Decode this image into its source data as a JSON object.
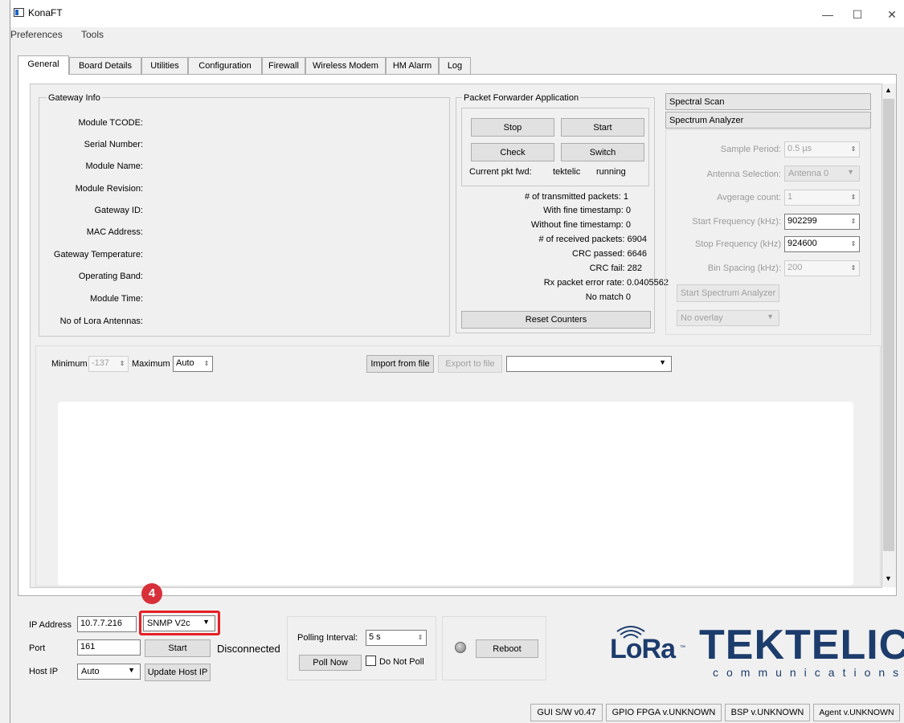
{
  "window": {
    "title": "KonaFT",
    "minimize": "—",
    "maximize": "☐",
    "close": "✕"
  },
  "menu": [
    "Preferences",
    "Tools"
  ],
  "tabs": [
    "General",
    "Board Details",
    "Utilities",
    "Configuration",
    "Firewall",
    "Wireless Modem",
    "HM Alarm",
    "Log"
  ],
  "gateway_info": {
    "title": "Gateway Info",
    "labels": [
      "Module TCODE:",
      "Serial Number:",
      "Module Name:",
      "Module Revision:",
      "Gateway ID:",
      "MAC Address:",
      "Gateway Temperature:",
      "Operating Band:",
      "Module Time:",
      "No of Lora Antennas:"
    ]
  },
  "packet_forwarder": {
    "title": "Packet Forwarder Application",
    "stop": "Stop",
    "start": "Start",
    "check": "Check",
    "switch": "Switch",
    "current_label": "Current pkt fwd:",
    "current_name": "tektelic",
    "current_state": "running",
    "stats": [
      "# of transmitted packets:  1",
      "With fine timestamp:  0",
      "Without fine timestamp:  0",
      "# of received packets:  6904",
      "CRC passed:  6646",
      "CRC fail:  282",
      "Rx packet error rate:  0.0405562",
      "No match  0"
    ],
    "reset": "Reset Counters"
  },
  "spectral": {
    "tab1": "Spectral Scan",
    "tab2": "Spectrum Analyzer",
    "sample_period_label": "Sample Period:",
    "sample_period": "0.5 µs",
    "antenna_label": "Antenna Selection:",
    "antenna": "Antenna 0",
    "avg_label": "Avgerage count:",
    "avg": "1",
    "start_freq_label": "Start Frequency (kHz):",
    "start_freq": "902299",
    "stop_freq_label": "Stop Frequency (kHz)",
    "stop_freq": "924600",
    "bin_label": "Bin Spacing (kHz):",
    "bin": "200",
    "start_btn": "Start Spectrum Analyzer",
    "overlay": "No overlay"
  },
  "plot_controls": {
    "min_label": "Minimum",
    "min": "-137",
    "max_label": "Maximum",
    "max": "Auto",
    "import": "Import from file",
    "export": "Export to file"
  },
  "connection": {
    "ip_label": "IP Address",
    "ip": "10.7.7.216",
    "protocol": "SNMP V2c",
    "port_label": "Port",
    "port": "161",
    "start": "Start",
    "status": "Disconnected",
    "host_label": "Host IP",
    "host": "Auto",
    "update_host": "Update Host IP"
  },
  "polling": {
    "label": "Polling Interval:",
    "value": "5 s",
    "poll_now": "Poll Now",
    "do_not_poll": "Do Not Poll"
  },
  "reboot": "Reboot",
  "badge": "4",
  "logo": {
    "lora": "LoRa",
    "tm": "™",
    "tektelic": "TEKTELIC",
    "sub": "communications"
  },
  "status_bar": [
    "GUI S/W v0.47",
    "GPIO FPGA v.UNKNOWN",
    "BSP v.UNKNOWN",
    "Agent v.UNKNOWN"
  ],
  "colors": {
    "accent_red": "#e42025",
    "brand_blue": "#1c3c6c"
  }
}
